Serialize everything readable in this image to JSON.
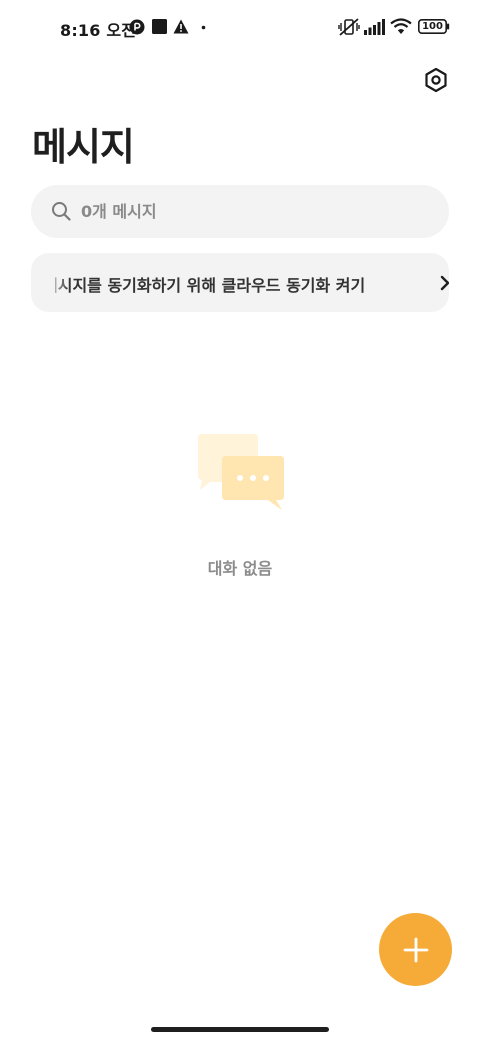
{
  "status_bar": {
    "time": "8:16 오전",
    "battery": "100",
    "icons": [
      "app-notification-icon",
      "square-notification-icon",
      "warning-icon",
      "dot-icon",
      "vibrate-off-icon",
      "signal-icon",
      "wifi-icon",
      "battery-icon"
    ]
  },
  "header": {
    "title": "메시지",
    "settings_icon": "settings-hexagon-icon"
  },
  "search": {
    "placeholder": "0개 메시지",
    "value": "",
    "icon": "search-icon"
  },
  "sync_banner": {
    "text": "메시지를 동기화하기 위해 클라우드 동기화 켜기",
    "icon": "chevron-right-icon"
  },
  "empty_state": {
    "icon": "chat-bubbles-icon",
    "text": "대화 없음"
  },
  "fab": {
    "icon": "plus-icon",
    "color": "#f6ab38"
  },
  "colors": {
    "accent": "#f6ab38",
    "surface": "#f3f3f3",
    "illustration_light": "#fff2d6",
    "illustration_dark": "#ffe6b3"
  }
}
